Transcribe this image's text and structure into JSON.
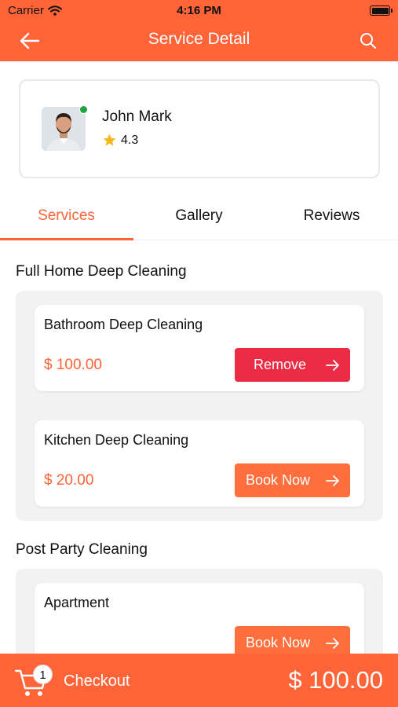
{
  "status_bar": {
    "carrier": "Carrier",
    "time": "4:16 PM"
  },
  "header": {
    "title": "Service Detail"
  },
  "provider": {
    "name": "John Mark",
    "rating": "4.3",
    "online": true
  },
  "tabs": [
    {
      "label": "Services",
      "active": true
    },
    {
      "label": "Gallery",
      "active": false
    },
    {
      "label": "Reviews",
      "active": false
    }
  ],
  "sections": [
    {
      "title": "Full Home Deep Cleaning",
      "services": [
        {
          "name": "Bathroom Deep Cleaning",
          "price": "$ 100.00",
          "action": "Remove"
        },
        {
          "name": "Kitchen Deep Cleaning",
          "price": "$ 20.00",
          "action": "Book Now"
        }
      ]
    },
    {
      "title": "Post Party Cleaning",
      "services": [
        {
          "name": "Apartment",
          "price": "",
          "action": "Book Now"
        }
      ]
    }
  ],
  "checkout": {
    "label": "Checkout",
    "cart_count": "1",
    "total": "$ 100.00"
  },
  "colors": {
    "primary": "#ff6438",
    "remove": "#ec2b44",
    "book": "#ff6f3e",
    "online": "#1ea53d",
    "star": "#f5b91c"
  }
}
